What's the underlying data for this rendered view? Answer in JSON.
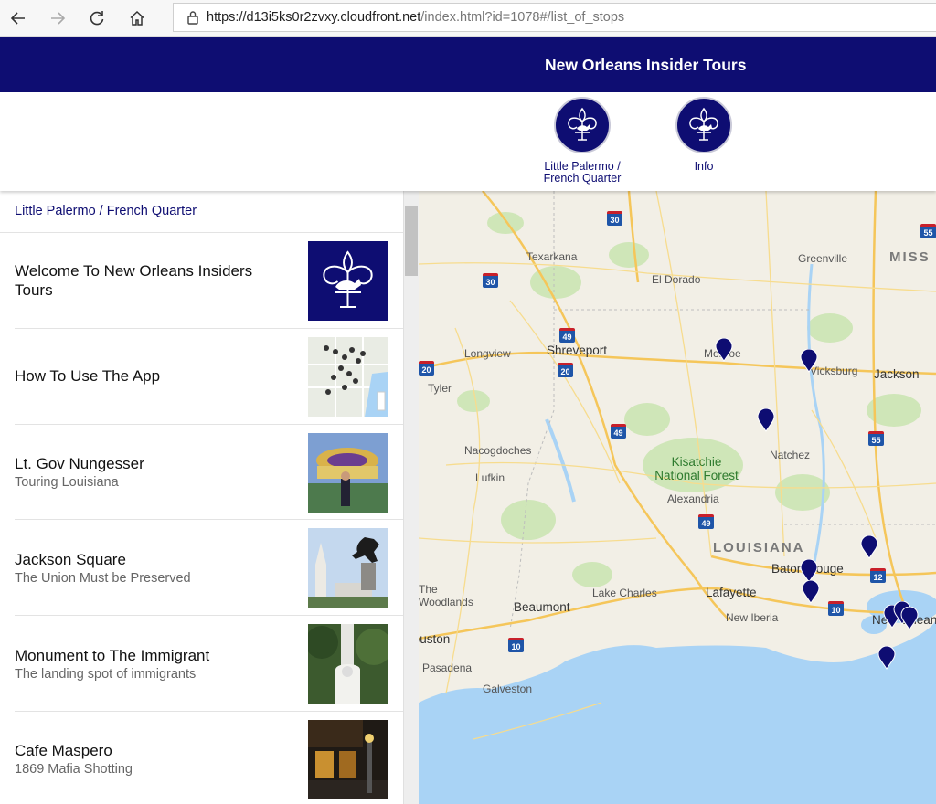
{
  "browser": {
    "url_host": "https://d13i5ks0r2zvxy.cloudfront.net",
    "url_path": "/index.html?id=1078#/list_of_stops"
  },
  "app": {
    "title": "New Orleans Insider Tours"
  },
  "tabs": [
    {
      "label": "Little Palermo / French Quarter"
    },
    {
      "label": "Info"
    }
  ],
  "list": {
    "heading": "Little Palermo / French Quarter",
    "stops": [
      {
        "title": "Welcome To New Orleans Insiders Tours",
        "subtitle": ""
      },
      {
        "title": "How To Use The App",
        "subtitle": ""
      },
      {
        "title": "Lt. Gov Nungesser",
        "subtitle": "Touring Louisiana"
      },
      {
        "title": "Jackson Square",
        "subtitle": "The Union Must be Preserved"
      },
      {
        "title": "Monument to The Immigrant",
        "subtitle": "The landing spot of immigrants"
      },
      {
        "title": "Cafe Maspero",
        "subtitle": "1869 Mafia Shotting"
      }
    ]
  },
  "map": {
    "cities": {
      "texarkana": "Texarkana",
      "el_dorado": "El Dorado",
      "greenville": "Greenville",
      "longview": "Longview",
      "shreveport": "Shreveport",
      "monroe": "Monroe",
      "vicksburg": "Vicksburg",
      "jackson": "Jackson",
      "tyler": "Tyler",
      "nacogdoches": "Nacogdoches",
      "natchez": "Natchez",
      "lufkin": "Lufkin",
      "alexandria": "Alexandria",
      "baton_rouge": "Baton Rouge",
      "lake_charles": "Lake Charles",
      "lafayette": "Lafayette",
      "beaumont": "Beaumont",
      "new_iberia": "New Iberia",
      "houston": "Houston",
      "pasadena": "Pasadena",
      "galveston": "Galveston",
      "new_orleans": "New Orleans",
      "woodlands": "The Woodlands"
    },
    "regions": {
      "louisiana": "LOUISIANA",
      "mississippi": "MISS"
    },
    "forest": "Kisatchie National Forest",
    "highways": {
      "i30a": "30",
      "i30b": "30",
      "i49a": "49",
      "i49b": "49",
      "i49c": "49",
      "i20a": "20",
      "i20b": "20",
      "i55": "55",
      "i55b": "55",
      "i12": "12",
      "i10a": "10",
      "i10b": "10"
    },
    "marker_color": "#0e0d72"
  }
}
